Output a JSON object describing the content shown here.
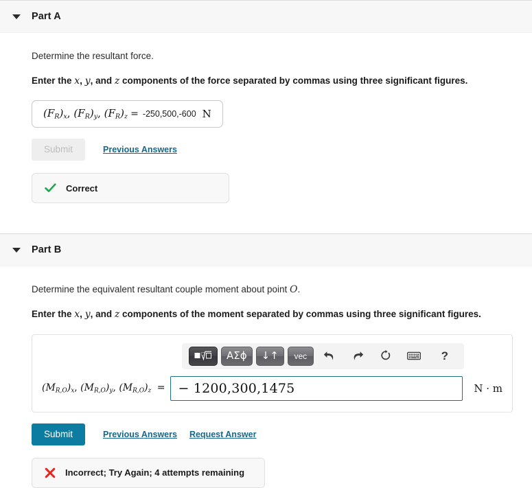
{
  "parts": [
    {
      "id": "part-a",
      "title": "Part A",
      "caret_icon": "caret-down-icon",
      "prompt": "Determine the resultant force.",
      "instruction_pre": "Enter the ",
      "instruction_x": "x",
      "instruction_sep1": ", ",
      "instruction_y": "y",
      "instruction_sep2": ", and ",
      "instruction_z": "z",
      "instruction_post": " components of the force separated by commas using three significant figures.",
      "answer": {
        "label_parts": [
          "(F",
          "R",
          ")",
          "x",
          "(F",
          "R",
          ")",
          "y",
          "(F",
          "R",
          ")",
          "z"
        ],
        "equals": "=",
        "value": "-250,500,-600",
        "unit": "N"
      },
      "submit_label": "Submit",
      "submit_disabled": true,
      "links": [
        "Previous Answers"
      ],
      "feedback": {
        "icon": "check-icon",
        "text": "Correct",
        "status": "correct",
        "color": "#1ba94c"
      }
    },
    {
      "id": "part-b",
      "title": "Part B",
      "caret_icon": "caret-down-icon",
      "prompt_pre": "Determine the equivalent resultant couple moment about point ",
      "prompt_var": "O",
      "prompt_post": ".",
      "instruction_pre": "Enter the ",
      "instruction_x": "x",
      "instruction_sep1": ", ",
      "instruction_y": "y",
      "instruction_sep2": ", and ",
      "instruction_z": "z",
      "instruction_post": " components of the moment separated by commas using three significant figures.",
      "toolbar": {
        "buttons": [
          {
            "name": "template-root-button",
            "glyph": "■√□",
            "label": "square-root-template"
          },
          {
            "name": "greek-symbols-button",
            "glyph": "ΑΣϕ",
            "label": "greek-symbols"
          },
          {
            "name": "arrows-button",
            "glyph": "↓↑",
            "label": "arrows"
          },
          {
            "name": "vector-button",
            "glyph": "vec",
            "label": "vector"
          }
        ],
        "icons": [
          {
            "name": "undo-icon",
            "label": "undo"
          },
          {
            "name": "redo-icon",
            "label": "redo"
          },
          {
            "name": "reset-icon",
            "label": "reset"
          },
          {
            "name": "keyboard-icon",
            "label": "keyboard"
          },
          {
            "name": "help-icon",
            "label": "?"
          }
        ]
      },
      "answer": {
        "equals": "=",
        "value": "− 1200,300,1475",
        "unit": "N · m"
      },
      "submit_label": "Submit",
      "submit_disabled": false,
      "links": [
        "Previous Answers",
        "Request Answer"
      ],
      "feedback": {
        "icon": "cross-icon",
        "text": "Incorrect; Try Again; 4 attempts remaining",
        "status": "incorrect",
        "color": "#e8241f"
      }
    }
  ],
  "colors": {
    "submit_active": "#0d7ca1",
    "link": "#15688c",
    "correct": "#1ba94c",
    "incorrect": "#e8241f",
    "input_border": "#1d6f91",
    "header_band": "#f7f7f7"
  }
}
